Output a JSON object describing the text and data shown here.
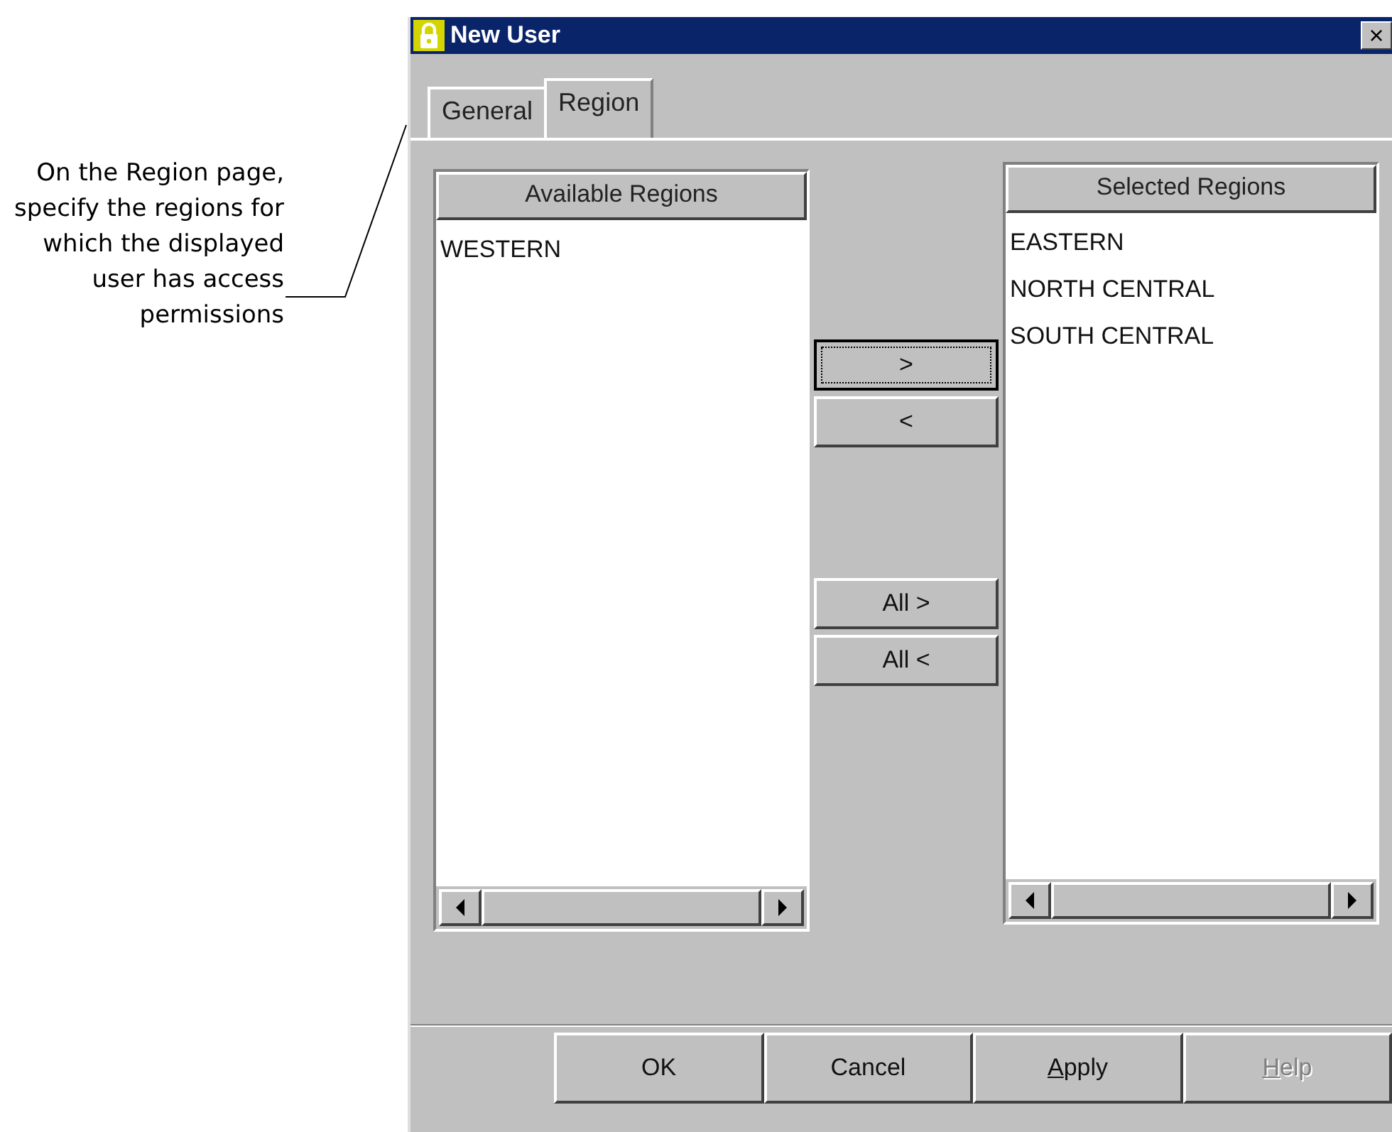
{
  "annotation": {
    "text": "On the Region page, specify the regions for which the displayed user has access permissions"
  },
  "window": {
    "title": "New User",
    "close": "×"
  },
  "tabs": [
    {
      "label": "General",
      "selected": false
    },
    {
      "label": "Region",
      "selected": true
    }
  ],
  "available": {
    "header": "Available Regions",
    "items": [
      "WESTERN"
    ]
  },
  "move_buttons": [
    {
      "label": ">",
      "focused": true
    },
    {
      "label": "<",
      "focused": false
    },
    {
      "label": "All >",
      "focused": false
    },
    {
      "label": "All <",
      "focused": false
    }
  ],
  "selected": {
    "header": "Selected Regions",
    "items": [
      "EASTERN",
      "NORTH CENTRAL",
      "SOUTH CENTRAL"
    ]
  },
  "buttons": [
    {
      "label": "OK",
      "underline_first": false,
      "disabled": false
    },
    {
      "label": "Cancel",
      "underline_first": false,
      "disabled": false
    },
    {
      "label": "Apply",
      "underline_first": true,
      "disabled": false
    },
    {
      "label": "Help",
      "underline_first": true,
      "disabled": true
    }
  ]
}
